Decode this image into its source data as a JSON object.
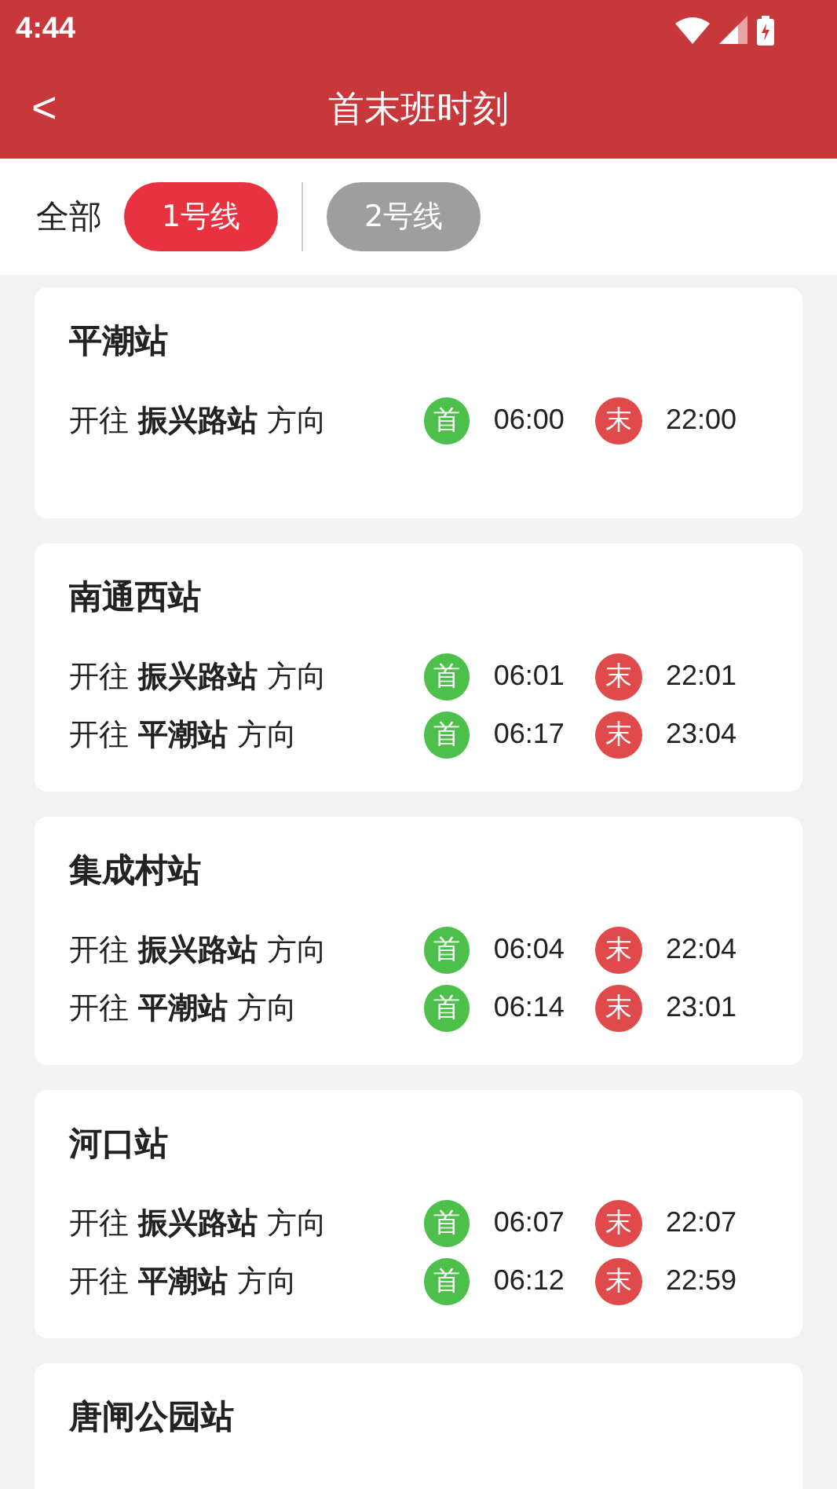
{
  "status_bar": {
    "time": "4:44"
  },
  "header": {
    "back": "<",
    "title": "首末班时刻"
  },
  "filter": {
    "label": "全部",
    "lines": [
      {
        "label": "1号线",
        "selected": true
      },
      {
        "label": "2号线",
        "selected": false
      }
    ]
  },
  "stations": [
    {
      "name": "平潮站",
      "rows": [
        {
          "direction": "开往 **振兴路站** 方向",
          "first_badge": "首",
          "first": "06:00",
          "last_badge": "末",
          "last": "22:00"
        }
      ]
    },
    {
      "name": "南通西站",
      "rows": [
        {
          "direction": "开往 **振兴路站** 方向",
          "first_badge": "首",
          "first": "06:01",
          "last_badge": "末",
          "last": "22:01"
        },
        {
          "direction": "开往 **平潮站** 方向",
          "first_badge": "首",
          "first": "06:17",
          "last_badge": "末",
          "last": "23:04"
        }
      ]
    },
    {
      "name": "集成村站",
      "rows": [
        {
          "direction": "开往 **振兴路站** 方向",
          "first_badge": "首",
          "first": "06:04",
          "last_badge": "末",
          "last": "22:04"
        },
        {
          "direction": "开往 **平潮站** 方向",
          "first_badge": "首",
          "first": "06:14",
          "last_badge": "末",
          "last": "23:01"
        }
      ]
    },
    {
      "name": "河口站",
      "rows": [
        {
          "direction": "开往 **振兴路站** 方向",
          "first_badge": "首",
          "first": "06:07",
          "last_badge": "末",
          "last": "22:07"
        },
        {
          "direction": "开往 **平潮站** 方向",
          "first_badge": "首",
          "first": "06:12",
          "last_badge": "末",
          "last": "22:59"
        }
      ]
    },
    {
      "name": "唐闸公园站"
    }
  ]
}
